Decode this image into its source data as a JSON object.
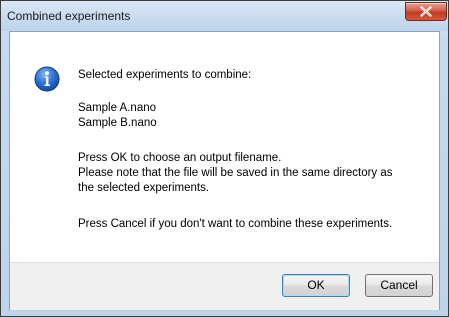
{
  "window": {
    "title": "Combined experiments"
  },
  "message": {
    "heading": "Selected experiments to combine:",
    "files": [
      "Sample A.nano",
      "Sample B.nano"
    ],
    "ok_instructions": [
      "Press OK to choose an output filename.",
      "Please note that the file will be saved in the same directory as",
      "the selected experiments."
    ],
    "cancel_instructions": "Press Cancel if you don't want to combine these experiments."
  },
  "buttons": {
    "ok_label": "OK",
    "cancel_label": "Cancel"
  },
  "icons": {
    "info": "info-icon",
    "close": "close-icon"
  },
  "colors": {
    "titlebar": "#c9dcf0",
    "close_button": "#c94a33",
    "info_icon": "#1c5bb8",
    "footer": "#f0f0f0"
  }
}
